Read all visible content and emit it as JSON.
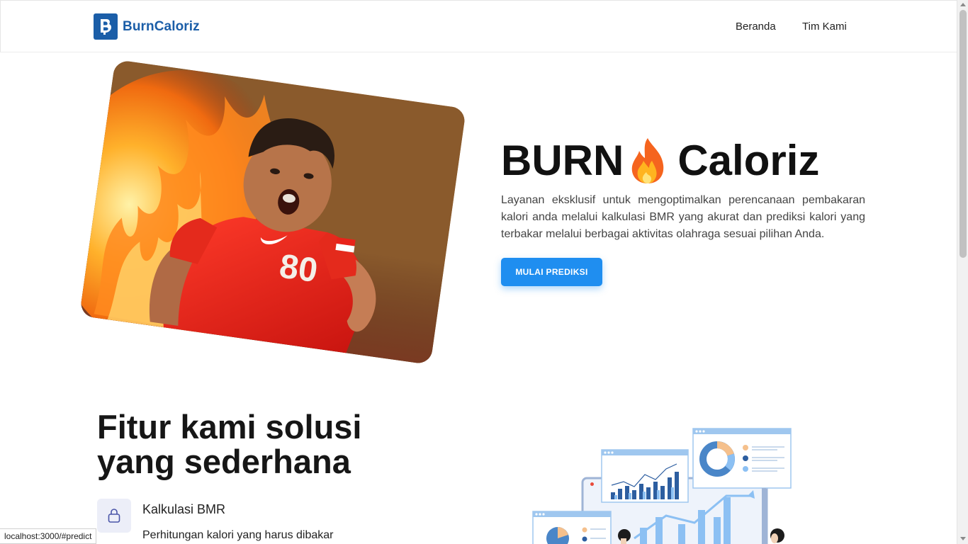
{
  "nav": {
    "brand": "BurnCaloriz",
    "links": [
      "Beranda",
      "Tim Kami"
    ]
  },
  "hero": {
    "title_left": "BURN",
    "title_right": "Caloriz",
    "jersey_number": "80",
    "description": "Layanan eksklusif untuk mengoptimalkan perencanaan pembakaran kalori anda melalui kalkulasi BMR yang akurat dan prediksi kalori yang terbakar melalui berbagai aktivitas olahraga sesuai pilihan Anda.",
    "cta": "MULAI PREDIKSI"
  },
  "features": {
    "title_line1": "Fitur kami solusi",
    "title_line2": "yang sederhana",
    "items": [
      {
        "icon": "lock-icon",
        "name": "Kalkulasi BMR",
        "desc": "Perhitungan kalori yang harus dibakar"
      }
    ]
  },
  "status_bar": {
    "url": "localhost:3000/#predict"
  },
  "colors": {
    "brand": "#1b5ea8",
    "accent": "#1f8ef0"
  }
}
